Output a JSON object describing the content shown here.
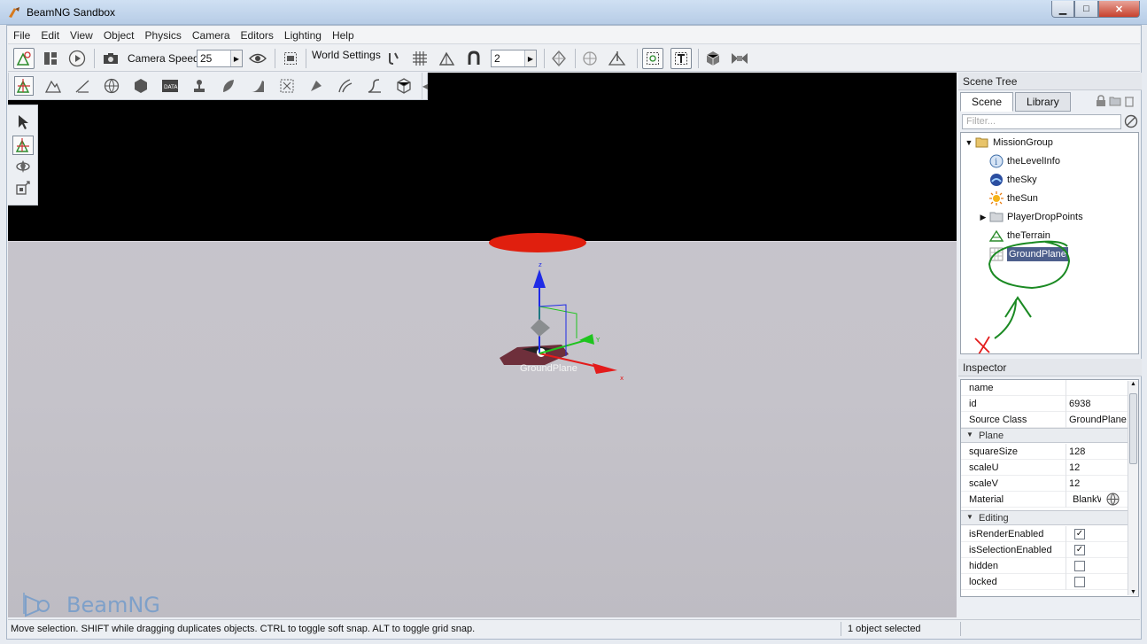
{
  "window": {
    "title": "BeamNG Sandbox"
  },
  "menu": [
    "File",
    "Edit",
    "View",
    "Object",
    "Physics",
    "Camera",
    "Editors",
    "Lighting",
    "Help"
  ],
  "toolbar": {
    "camera_speed_label": "Camera Speed",
    "camera_speed_value": "25",
    "world_settings_label": "World Settings",
    "snap_value": "2"
  },
  "viewport": {
    "selected_object_label": "GroundPlane",
    "logo_text": "BeamNG"
  },
  "scene_tree": {
    "header": "Scene Tree",
    "tabs": [
      "Scene",
      "Library"
    ],
    "active_tab": "Scene",
    "filter_placeholder": "Filter...",
    "items": [
      {
        "label": "MissionGroup",
        "icon": "folder-open-icon",
        "depth": 0,
        "expanded": true
      },
      {
        "label": "theLevelInfo",
        "icon": "info-icon",
        "depth": 1
      },
      {
        "label": "theSky",
        "icon": "sky-icon",
        "depth": 1
      },
      {
        "label": "theSun",
        "icon": "sun-icon",
        "depth": 1
      },
      {
        "label": "PlayerDropPoints",
        "icon": "folder-icon",
        "depth": 1,
        "expandable": true
      },
      {
        "label": "theTerrain",
        "icon": "terrain-icon",
        "depth": 1
      },
      {
        "label": "GroundPlane",
        "icon": "grid-icon",
        "depth": 1,
        "selected": true
      }
    ]
  },
  "inspector": {
    "header": "Inspector",
    "fields": [
      {
        "name": "name",
        "value": ""
      },
      {
        "name": "id",
        "value": "6938"
      },
      {
        "name": "Source Class",
        "value": "GroundPlane"
      }
    ],
    "groups": [
      {
        "label": "Plane",
        "fields": [
          {
            "name": "squareSize",
            "value": "128"
          },
          {
            "name": "scaleU",
            "value": "12"
          },
          {
            "name": "scaleV",
            "value": "12"
          },
          {
            "name": "Material",
            "value": "BlankW"
          }
        ]
      },
      {
        "label": "Editing",
        "fields": [
          {
            "name": "isRenderEnabled",
            "checked": true
          },
          {
            "name": "isSelectionEnabled",
            "checked": true
          },
          {
            "name": "hidden",
            "checked": false
          },
          {
            "name": "locked",
            "checked": false
          }
        ]
      }
    ]
  },
  "status": {
    "message": "Move selection.  SHIFT while dragging duplicates objects.  CTRL to toggle soft snap.  ALT to toggle grid snap.",
    "selection": "1 object selected"
  },
  "colors": {
    "selection": "#4d5f8c",
    "annotation": "#1b8a23",
    "gizmo_x": "#e31b1b",
    "gizmo_y": "#1ec41e",
    "gizmo_z": "#1f2be6"
  }
}
